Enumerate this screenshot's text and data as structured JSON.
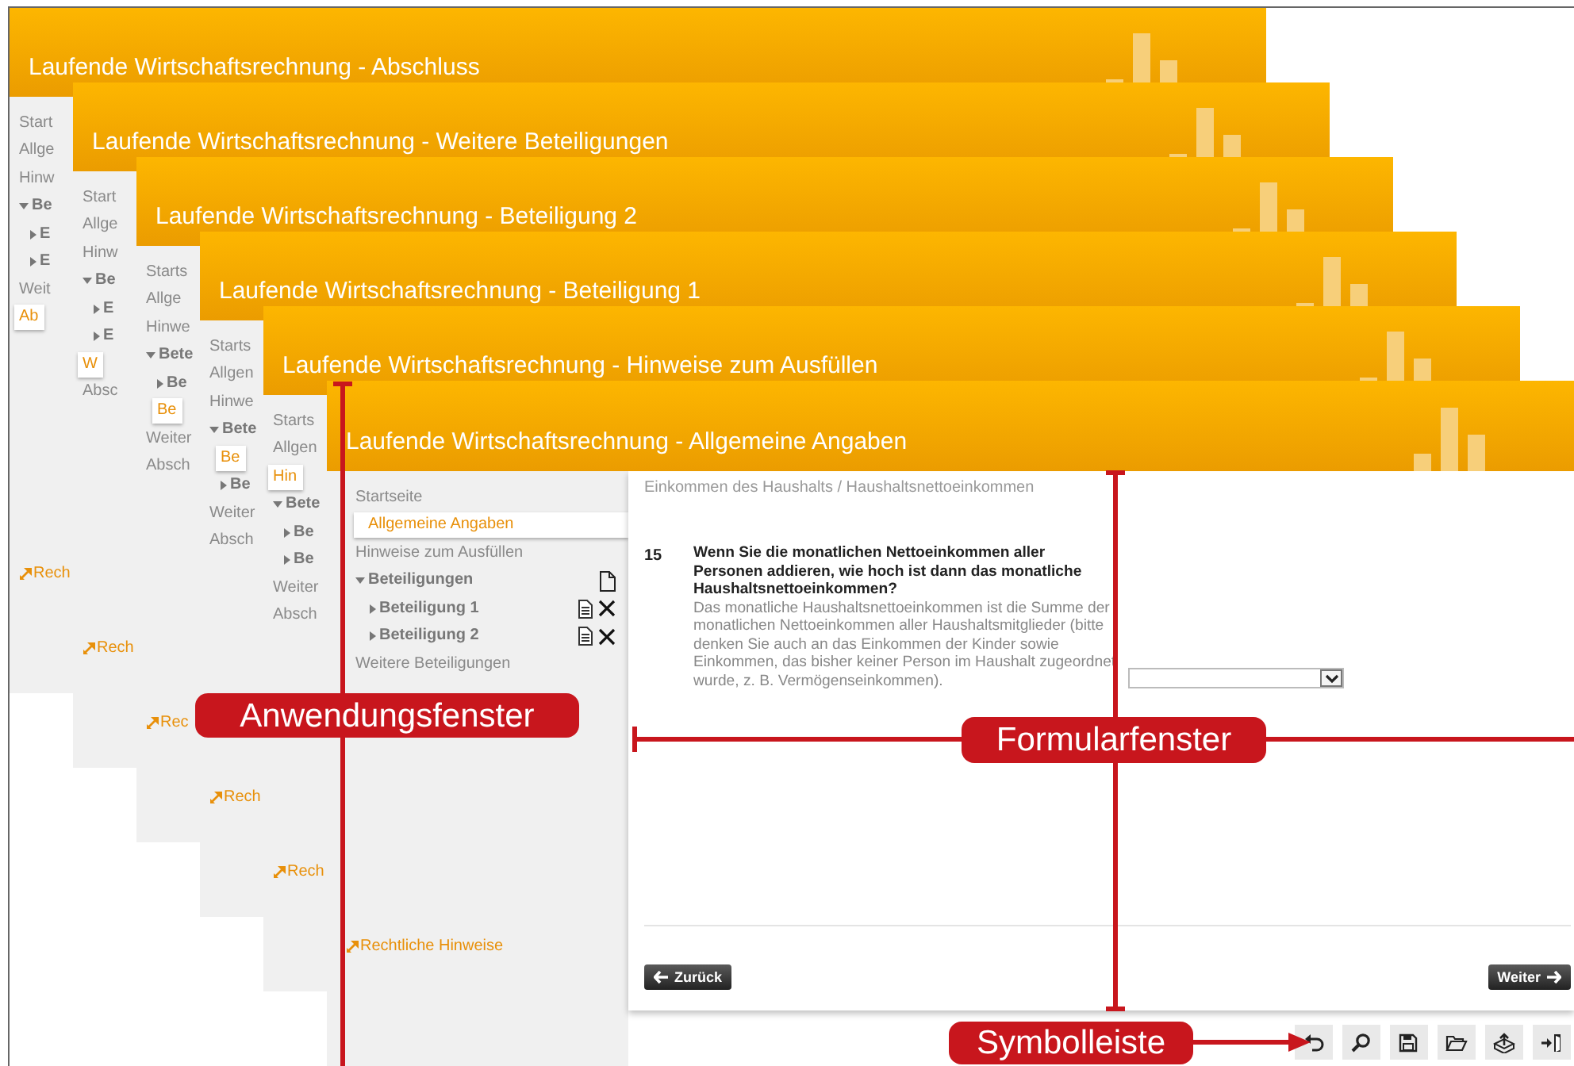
{
  "windows": [
    {
      "kind": "back",
      "title": "Laufende Wirtschaftsrechnung - Abschluss",
      "sidebar": [
        {
          "text": "Start",
          "selected": false
        },
        {
          "text": "Allge",
          "selected": false
        },
        {
          "text": "Hinw",
          "selected": false
        },
        {
          "text": "Be",
          "selected": false,
          "expanded": true,
          "children": [
            {
              "text": "E",
              "selected": false,
              "expanded": false
            },
            {
              "text": "E",
              "selected": false,
              "expanded": false
            }
          ]
        },
        {
          "text": "Weit",
          "selected": false
        },
        {
          "text": "Ab",
          "selected": true
        }
      ],
      "legal_link": "Rech"
    },
    {
      "kind": "back",
      "title": "Laufende Wirtschaftsrechnung - Weitere Beteiligungen",
      "sidebar": [
        {
          "text": "Start",
          "selected": false
        },
        {
          "text": "Allge",
          "selected": false
        },
        {
          "text": "Hinw",
          "selected": false
        },
        {
          "text": "Be",
          "selected": false,
          "expanded": true,
          "children": [
            {
              "text": "E",
              "selected": false,
              "expanded": false
            },
            {
              "text": "E",
              "selected": false,
              "expanded": false
            }
          ]
        },
        {
          "text": "W",
          "selected": true
        },
        {
          "text": "Absc",
          "selected": false
        }
      ],
      "legal_link": "Rech"
    },
    {
      "kind": "back",
      "title": "Laufende Wirtschaftsrechnung - Beteiligung 2",
      "sidebar": [
        {
          "text": "Starts",
          "selected": false
        },
        {
          "text": "Allge",
          "selected": false
        },
        {
          "text": "Hinwe",
          "selected": false
        },
        {
          "text": "Bete",
          "selected": false,
          "expanded": true,
          "children": [
            {
              "text": "Be",
              "selected": false,
              "expanded": false
            },
            {
              "text": "Be",
              "selected": true
            }
          ]
        },
        {
          "text": "Weiter",
          "selected": false
        },
        {
          "text": "Absch",
          "selected": false
        }
      ],
      "legal_link": "Rec"
    },
    {
      "kind": "back",
      "title": "Laufende Wirtschaftsrechnung - Beteiligung 1",
      "sidebar": [
        {
          "text": "Starts",
          "selected": false
        },
        {
          "text": "Allgen",
          "selected": false
        },
        {
          "text": "Hinwe",
          "selected": false
        },
        {
          "text": "Bete",
          "selected": false,
          "expanded": true,
          "children": [
            {
              "text": "Be",
              "selected": true
            },
            {
              "text": "Be",
              "selected": false,
              "expanded": false
            }
          ]
        },
        {
          "text": "Weiter",
          "selected": false
        },
        {
          "text": "Absch",
          "selected": false
        }
      ],
      "legal_link": "Rech"
    },
    {
      "kind": "back",
      "title": "Laufende Wirtschaftsrechnung - Hinweise zum Ausfüllen",
      "sidebar": [
        {
          "text": "Starts",
          "selected": false
        },
        {
          "text": "Allgen",
          "selected": false
        },
        {
          "text": "Hin",
          "selected": true
        },
        {
          "text": "Bete",
          "selected": false,
          "expanded": true,
          "children": [
            {
              "text": "Be",
              "selected": false,
              "expanded": false
            },
            {
              "text": "Be",
              "selected": false,
              "expanded": false
            }
          ]
        },
        {
          "text": "Weiter",
          "selected": false
        },
        {
          "text": "Absch",
          "selected": false
        }
      ],
      "legal_link": "Rech"
    },
    {
      "kind": "front",
      "title": "Laufende Wirtschaftsrechnung - Allgemeine Angaben",
      "sidebar": [
        {
          "text": "Startseite",
          "selected": false
        },
        {
          "text": "Allgemeine Angaben",
          "selected": true
        },
        {
          "text": "Hinweise zum Ausfüllen",
          "selected": false
        },
        {
          "text": "Beteiligungen",
          "selected": false,
          "expanded": true,
          "children": [
            {
              "text": "Beteiligung 1",
              "selected": false,
              "expanded": false
            },
            {
              "text": "Beteiligung 2",
              "selected": false,
              "expanded": false
            }
          ]
        },
        {
          "text": "Weitere Beteiligungen",
          "selected": false
        }
      ],
      "legal_link": "Rechtliche Hinweise",
      "form": {
        "breadcrumb": "Einkommen des Haushalts / Haushaltsnettoeinkommen",
        "number": "15",
        "question": "Wenn Sie die monatlichen Nettoeinkommen aller Personen addieren, wie hoch ist dann das monatliche Haushaltsnettoeinkommen?",
        "help": "Das monatliche Haushaltsnettoeinkommen ist die Summe der monatlichen Nettoeinkommen aller Haushaltsmitglieder (bitte denken Sie auch an das Einkommen der Kinder sowie Einkommen, das bisher keiner Person im Haushalt zugeordnet wurde, z. B. Vermögenseinkommen).",
        "back_button": "Zurück",
        "next_button": "Weiter"
      }
    }
  ],
  "annotations": [
    {
      "text": "Anwendungsfenster"
    },
    {
      "text": "Formularfenster"
    },
    {
      "text": "Symbolleiste"
    }
  ]
}
